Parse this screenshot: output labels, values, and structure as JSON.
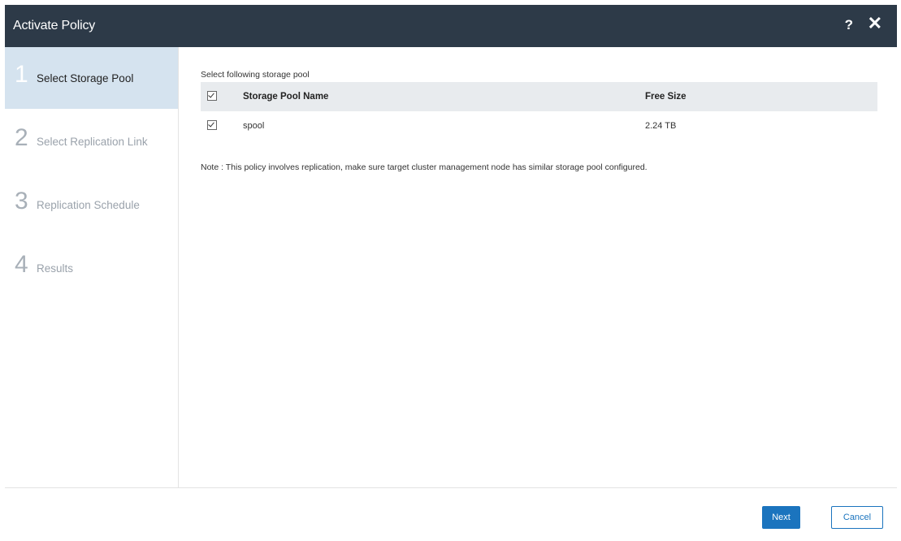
{
  "dialog": {
    "title": "Activate Policy",
    "help_label": "?",
    "close_label": "✕"
  },
  "steps": [
    {
      "number": "1",
      "label": "Select Storage Pool",
      "active": true
    },
    {
      "number": "2",
      "label": "Select Replication Link",
      "active": false
    },
    {
      "number": "3",
      "label": "Replication Schedule",
      "active": false
    },
    {
      "number": "4",
      "label": "Results",
      "active": false
    }
  ],
  "content": {
    "caption": "Select following storage pool",
    "columns": {
      "name": "Storage Pool Name",
      "size": "Free Size"
    },
    "rows": [
      {
        "name": "spool",
        "size": "2.24 TB",
        "checked": true
      }
    ],
    "note": "Note : This policy involves replication, make sure target cluster management node has similar storage pool configured."
  },
  "footer": {
    "next_label": "Next",
    "cancel_label": "Cancel"
  },
  "colors": {
    "titlebar": "#2d3a48",
    "active_step": "#d5e3ef",
    "primary": "#1b74be"
  }
}
